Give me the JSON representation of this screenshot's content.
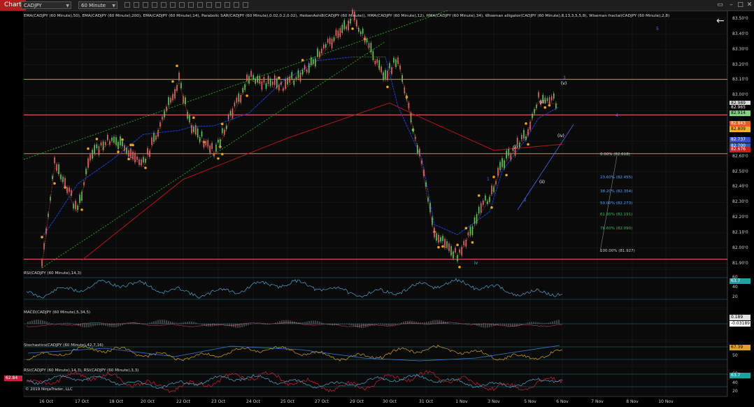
{
  "toolbar": {
    "tab_label": "Chart",
    "instrument": "CADJPY",
    "interval": "60 Minute",
    "back_icon": "back-arrow-icon"
  },
  "price_panel": {
    "indicator_header": "EMA(CADJPY (60 Minute),50), EMA(CADJPY (60 Minute),200), EMA(CADJPY (60 Minute),14), Parabolic SAR(CADJPY (60 Minute),0.02,0.2,0.02), HeikenAshi8(CADJPY (60 Minute)), HMA(CADJPY (60 Minute),12), HMA(CADJPY (60 Minute),34), Wiseman alligator(CADJPY (60 Minute),8,13,3,5,5,8), Wiseman fractal(CADJPY (60 Minute),2,8)",
    "axis_ticks": [
      "83.50'0",
      "83.40'0",
      "83.30'0",
      "83.20'0",
      "83.10'0",
      "83.00'0",
      "82.90'0",
      "82.80'0",
      "82.70'0",
      "82.60'0",
      "82.50'0",
      "82.40'0",
      "82.30'0",
      "82.20'0",
      "82.10'0",
      "82.00'0",
      "81.90'0"
    ],
    "price_tags": [
      {
        "text": "82.989",
        "bg": "#d8d8d8",
        "fg": "#000000"
      },
      {
        "text": "82.965",
        "bg": "#000000",
        "fg": "#ffffff"
      },
      {
        "text": "82.914",
        "bg": "#7fd07f",
        "fg": "#000000"
      },
      {
        "text": "82.843",
        "bg": "#e85a2a",
        "fg": "#ffffff"
      },
      {
        "text": "82.809",
        "bg": "#f0b030",
        "fg": "#000000"
      },
      {
        "text": "82.737",
        "bg": "#3050d0",
        "fg": "#ffffff"
      },
      {
        "text": "82.700",
        "bg": "#2060c0",
        "fg": "#ffffff"
      },
      {
        "text": "82.676",
        "bg": "#c82020",
        "fg": "#ffffff"
      }
    ],
    "horizontal_levels": [
      83.105,
      82.872,
      82.618,
      81.927
    ],
    "fib_levels": [
      {
        "text": "0.00% (82.618)",
        "color": "#cfcfcf"
      },
      {
        "text": "23.60% (82.455)",
        "color": "#4aa0ff"
      },
      {
        "text": "38.20% (82.354)",
        "color": "#4aa0ff"
      },
      {
        "text": "50.00% (82.273)",
        "color": "#4aa0ff"
      },
      {
        "text": "61.80% (82.191)",
        "color": "#2fbf5f"
      },
      {
        "text": "78.60% (82.090)",
        "color": "#2fbf5f"
      },
      {
        "text": "100.00% (81.927)",
        "color": "#cfcfcf"
      }
    ],
    "wave_labels": [
      {
        "text": "5",
        "color": "#5070ff"
      },
      {
        "text": "3",
        "color": "#5070ff"
      },
      {
        "text": "(v)",
        "color": "#ffffff"
      },
      {
        "text": "4",
        "color": "#5070ff"
      },
      {
        "text": "(iii)",
        "color": "#ffffff"
      },
      {
        "text": "(iv)",
        "color": "#ffffff"
      },
      {
        "text": "(i)",
        "color": "#ffffff"
      },
      {
        "text": "(ii)",
        "color": "#ffffff"
      },
      {
        "text": "1",
        "color": "#5070ff"
      },
      {
        "text": "2",
        "color": "#5070ff"
      },
      {
        "text": "iv",
        "color": "#20d0d0"
      }
    ]
  },
  "rsi_panel": {
    "label": "RSI(CADJPY (60 Minute),14,3)",
    "value_tag": "63.7",
    "axis_ticks": [
      "60",
      "40",
      "20"
    ]
  },
  "macd_panel": {
    "label": "MACD(CADJPY (60 Minute),5,34,5)",
    "value_tags": [
      "0.189",
      "-0.03189"
    ]
  },
  "stoch_panel": {
    "label": "Stochastics(CADJPY (60 Minute),42,7,16)",
    "value_tag": "67.39",
    "axis_ticks": [
      "50"
    ]
  },
  "rsi2_panel": {
    "label": "RSI(CADJPY (60 Minute),14,3), RSI(CADJPY (60 Minute),3,3)",
    "left_tag": "62.84",
    "value_tag": "63.7",
    "axis_ticks": [
      "60",
      "40",
      "20"
    ]
  },
  "copyright": "© 2019 NinjaTrader, LLC",
  "x_axis": [
    "16 Oct",
    "17 Oct",
    "18 Oct",
    "20 Oct",
    "22 Oct",
    "23 Oct",
    "24 Oct",
    "25 Oct",
    "27 Oct",
    "29 Oct",
    "30 Oct",
    "31 Oct",
    "1 Nov",
    "3 Nov",
    "5 Nov",
    "6 Nov",
    "7 Nov",
    "8 Nov",
    "10 Nov"
  ],
  "colors": {
    "background": "#000000",
    "grid": "#1f1f1f",
    "resistance_line": "#ff6b6b",
    "channel": "#22c022",
    "ema50": "#1f3fd0",
    "ema200": "#b01818",
    "sar": "#f0a020",
    "hma": "#e05020"
  },
  "chart_data": {
    "type": "line",
    "instrument": "CADJPY",
    "interval": "60 Minute",
    "ylim": [
      81.88,
      83.56
    ],
    "approx_price_path": [
      {
        "x": "16 Oct",
        "y": 81.9
      },
      {
        "x": "16 Oct",
        "y": 82.55
      },
      {
        "x": "17 Oct",
        "y": 82.25
      },
      {
        "x": "17 Oct",
        "y": 82.6
      },
      {
        "x": "18 Oct",
        "y": 82.72
      },
      {
        "x": "20 Oct",
        "y": 82.55
      },
      {
        "x": "22 Oct",
        "y": 83.1
      },
      {
        "x": "22 Oct",
        "y": 82.8
      },
      {
        "x": "23 Oct",
        "y": 82.62
      },
      {
        "x": "24 Oct",
        "y": 83.12
      },
      {
        "x": "25 Oct",
        "y": 83.05
      },
      {
        "x": "27 Oct",
        "y": 83.25
      },
      {
        "x": "29 Oct",
        "y": 83.52
      },
      {
        "x": "30 Oct",
        "y": 83.12
      },
      {
        "x": "30 Oct",
        "y": 83.25
      },
      {
        "x": "31 Oct",
        "y": 82.55
      },
      {
        "x": "31 Oct",
        "y": 82.1
      },
      {
        "x": "1 Nov",
        "y": 81.95
      },
      {
        "x": "3 Nov",
        "y": 82.35
      },
      {
        "x": "3 Nov",
        "y": 82.55
      },
      {
        "x": "5 Nov",
        "y": 82.75
      },
      {
        "x": "5 Nov",
        "y": 82.98
      },
      {
        "x": "6 Nov",
        "y": 82.96
      }
    ],
    "ema200_path": [
      {
        "x": "17 Oct",
        "y": 81.92
      },
      {
        "x": "22 Oct",
        "y": 82.45
      },
      {
        "x": "25 Oct",
        "y": 82.72
      },
      {
        "x": "30 Oct",
        "y": 82.95
      },
      {
        "x": "31 Oct",
        "y": 82.84
      },
      {
        "x": "3 Nov",
        "y": 82.64
      },
      {
        "x": "6 Nov",
        "y": 82.68
      }
    ]
  }
}
